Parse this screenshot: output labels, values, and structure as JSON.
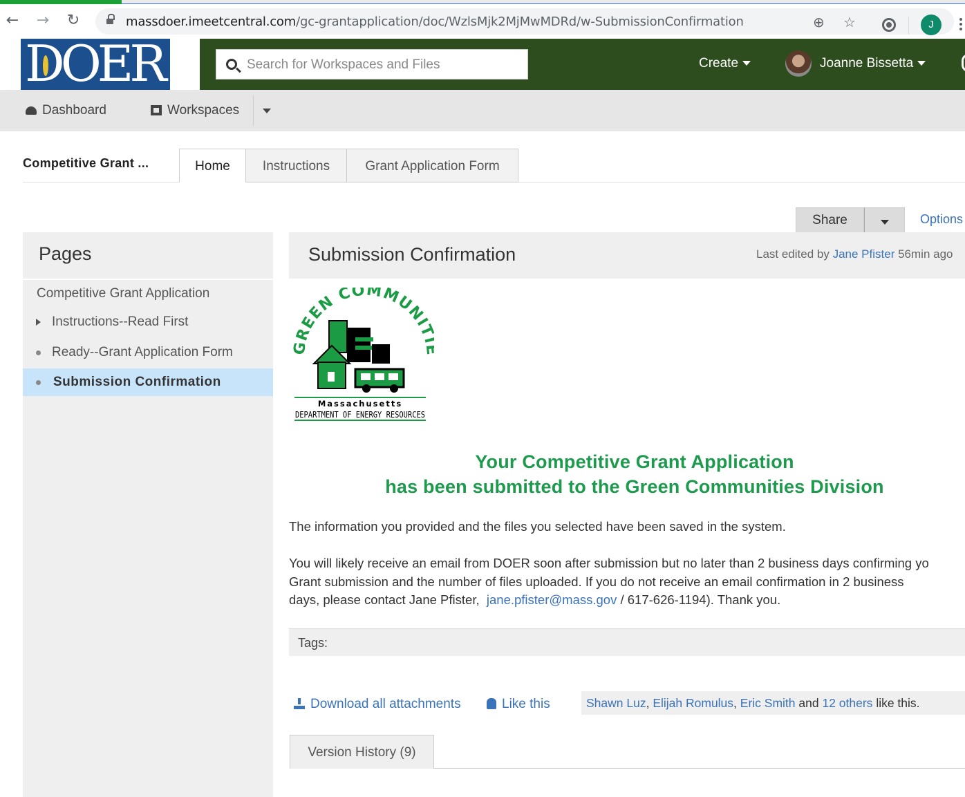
{
  "browser": {
    "url_host": "massdoer.imeetcentral.com",
    "url_path": "/gc-grantapplication/doc/WzlsMjk2MjMwMDRd/w-SubmissionConfirmation",
    "profile_initial": "J"
  },
  "header": {
    "logo": "DOER",
    "search_placeholder": "Search for Workspaces and Files",
    "create_label": "Create",
    "user_name": "Joanne Bissetta"
  },
  "subnav": {
    "dashboard": "Dashboard",
    "workspaces": "Workspaces"
  },
  "workspace": {
    "name": "Competitive Grant ...",
    "tabs": [
      "Home",
      "Instructions",
      "Grant Application Form"
    ],
    "active_tab": "Home"
  },
  "actions": {
    "share": "Share",
    "options": "Options"
  },
  "sidebar": {
    "title": "Pages",
    "items": [
      {
        "label": "Competitive Grant Application",
        "marker": "none"
      },
      {
        "label": "Instructions--Read First",
        "marker": "triangle"
      },
      {
        "label": "Ready--Grant Application Form",
        "marker": "dot"
      },
      {
        "label": "Submission Confirmation",
        "marker": "dot",
        "current": true
      }
    ]
  },
  "page": {
    "title": "Submission Confirmation",
    "edited_prefix": "Last edited by",
    "edited_by": "Jane Pfister",
    "edited_ago": "56min ago",
    "logo_top_text": "GREEN COMMUNITIES",
    "logo_line1": "Massachusetts",
    "logo_line2": "DEPARTMENT OF ENERGY RESOURCES",
    "headline_line1": "Your Competitive Grant Application",
    "headline_line2": "has been submitted to the Green Communities Division",
    "para1": "The information you provided and the files you selected have been saved in the system.",
    "para2_line1": "You will likely receive an email from DOER soon after submission but no later than 2 business days confirming yo",
    "para2_line2": "Grant submission and the number of files uploaded. If you do not receive an email confirmation in 2 business",
    "para2_line3_pre": "days, please contact Jane Pfister,",
    "contact_email": "jane.pfister@mass.gov",
    "para2_line3_post": "/ 617-626-1194). Thank you.",
    "tags_label": "Tags:",
    "download_label": "Download all attachments",
    "like_label": "Like this",
    "likers": [
      "Shawn Luz",
      "Elijah Romulus",
      "Eric Smith"
    ],
    "likers_and": "and",
    "likers_others": "12 others",
    "likers_suffix": "like this.",
    "version_history": "Version History (9)"
  },
  "colors": {
    "header_green": "#2d4d1e",
    "logo_blue": "#1b4f8d",
    "headline_green": "#1d9a4d",
    "link_blue": "#3b73b9",
    "current_page_bg": "#c7e4fb"
  }
}
